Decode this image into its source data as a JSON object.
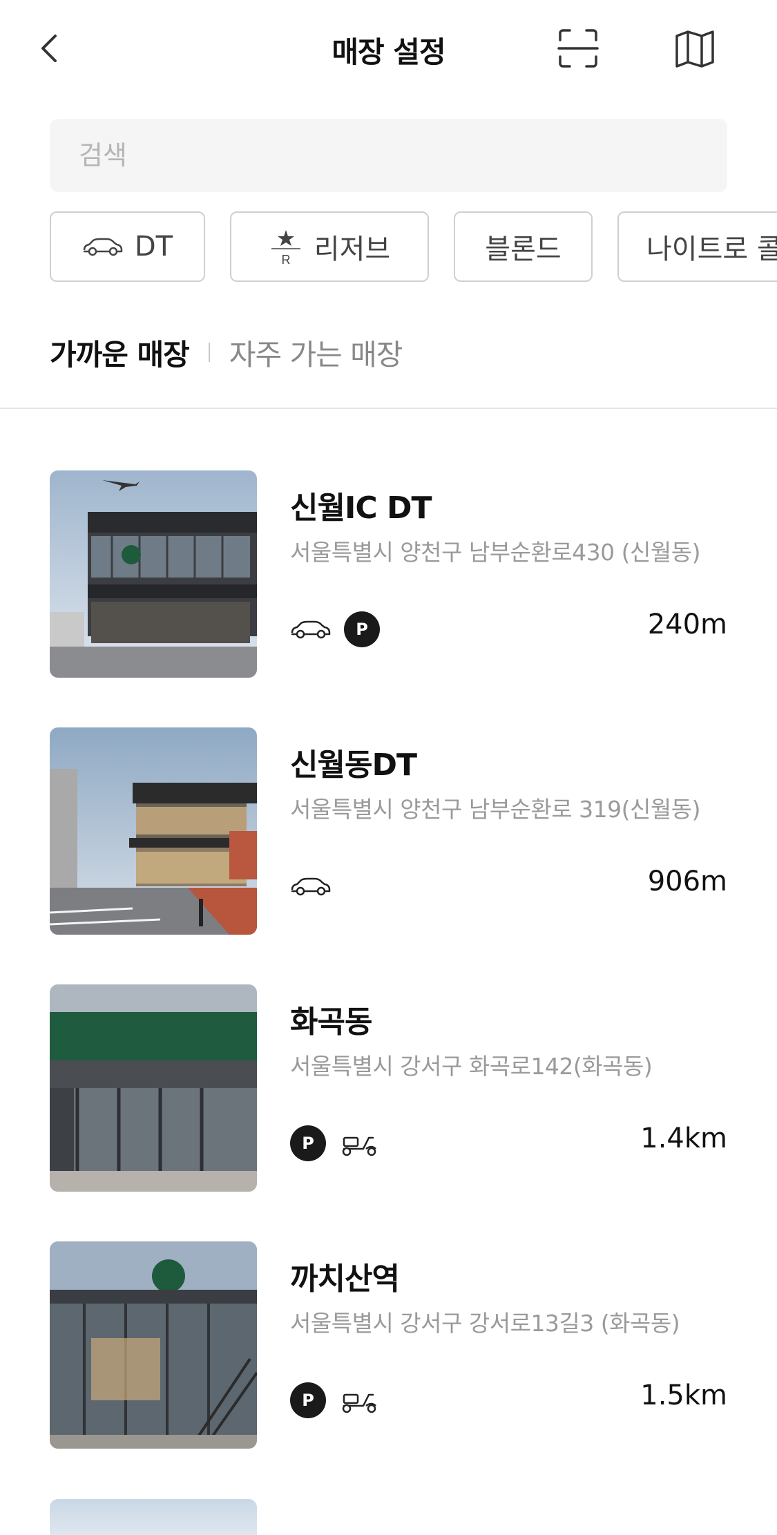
{
  "header": {
    "title": "매장 설정"
  },
  "search": {
    "placeholder": "검색"
  },
  "filters": [
    {
      "label": "DT",
      "icon": "car-icon"
    },
    {
      "label": "리저브",
      "icon": "reserve-star-icon"
    },
    {
      "label": "블론드"
    },
    {
      "label": "나이트로 콜"
    }
  ],
  "tabs": {
    "nearby": "가까운 매장",
    "frequent": "자주 가는 매장"
  },
  "stores": [
    {
      "name": "신월IC DT",
      "address": "서울특별시 양천구 남부순환로430 (신월동)",
      "distance": "240m",
      "icons": [
        "car-icon",
        "parking-icon"
      ]
    },
    {
      "name": "신월동DT",
      "address": "서울특별시 양천구 남부순환로 319(신월동)",
      "distance": "906m",
      "icons": [
        "car-icon"
      ]
    },
    {
      "name": "화곡동",
      "address": "서울특별시 강서구 화곡로142(화곡동)",
      "distance": "1.4km",
      "icons": [
        "parking-icon",
        "delivery-scooter-icon"
      ]
    },
    {
      "name": "까치산역",
      "address": "서울특별시 강서구 강서로13길3 (화곡동)",
      "distance": "1.5km",
      "icons": [
        "parking-icon",
        "delivery-scooter-icon"
      ]
    }
  ],
  "colors": {
    "parking_badge": "#1a1a1a",
    "address_text": "#9a9a9a",
    "chip_border": "#cfcfcf",
    "search_bg": "#f5f5f5"
  }
}
